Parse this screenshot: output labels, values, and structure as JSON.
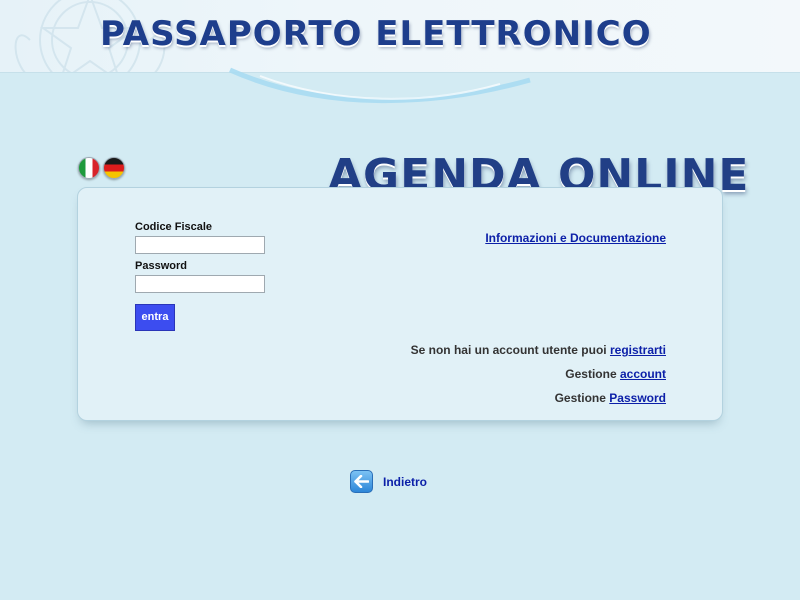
{
  "header": {
    "title": "PASSAPORTO ELETTRONICO"
  },
  "languages": [
    {
      "name": "Italiano",
      "icon": "italy-flag-icon"
    },
    {
      "name": "Deutsch",
      "icon": "germany-flag-icon"
    }
  ],
  "agenda": {
    "title": "AGENDA ONLINE"
  },
  "login": {
    "codice_fiscale_label": "Codice Fiscale",
    "codice_fiscale_value": "",
    "password_label": "Password",
    "password_value": "",
    "submit_label": "entra"
  },
  "links": {
    "info": "Informazioni e Documentazione",
    "register_prefix": "Se non hai un account utente puoi",
    "register_link": "registrarti",
    "account_prefix": "Gestione",
    "account_link": "account",
    "password_prefix": "Gestione",
    "password_link": "Password"
  },
  "back": {
    "label": "Indietro",
    "icon": "arrow-left-icon"
  },
  "colors": {
    "background": "#d3ebf3",
    "title": "#1e3e8c",
    "link": "#0b1fa8",
    "button": "#3c4df0"
  }
}
